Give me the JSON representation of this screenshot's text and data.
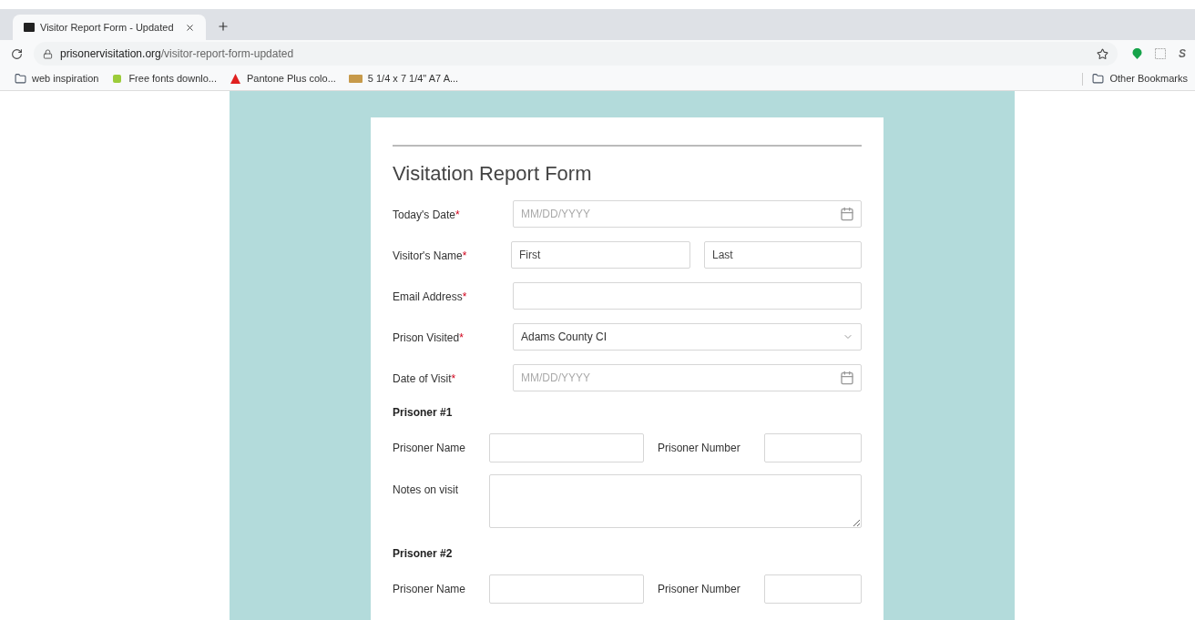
{
  "browser": {
    "tab": {
      "title": "Visitor Report Form - Updated"
    },
    "url": {
      "domain": "prisonervisitation.org",
      "path": "/visitor-report-form-updated"
    },
    "bookmarks": [
      "web inspiration",
      "Free fonts downlo...",
      "Pantone Plus colo...",
      "5 1/4 x 7 1/4\" A7 A..."
    ],
    "other_bookmarks": "Other Bookmarks",
    "extension_letter": "S"
  },
  "form": {
    "title": "Visitation Report Form",
    "required_mark": "*",
    "fields": [
      {
        "kind": "date",
        "label": "Today's Date",
        "required": true,
        "placeholder": "MM/DD/YYYY"
      },
      {
        "kind": "name",
        "label": "Visitor's Name",
        "required": true,
        "first_placeholder": "First",
        "last_placeholder": "Last"
      },
      {
        "kind": "text",
        "label": "Email Address",
        "required": true
      },
      {
        "kind": "select",
        "label": "Prison Visited",
        "required": true,
        "value": "Adams County CI"
      },
      {
        "kind": "date",
        "label": "Date of Visit",
        "required": true,
        "placeholder": "MM/DD/YYYY"
      }
    ],
    "prisoners": [
      {
        "heading": "Prisoner #1",
        "name_label": "Prisoner Name",
        "number_label": "Prisoner Number",
        "notes_label": "Notes on visit"
      },
      {
        "heading": "Prisoner #2",
        "name_label": "Prisoner Name",
        "number_label": "Prisoner Number"
      }
    ]
  }
}
